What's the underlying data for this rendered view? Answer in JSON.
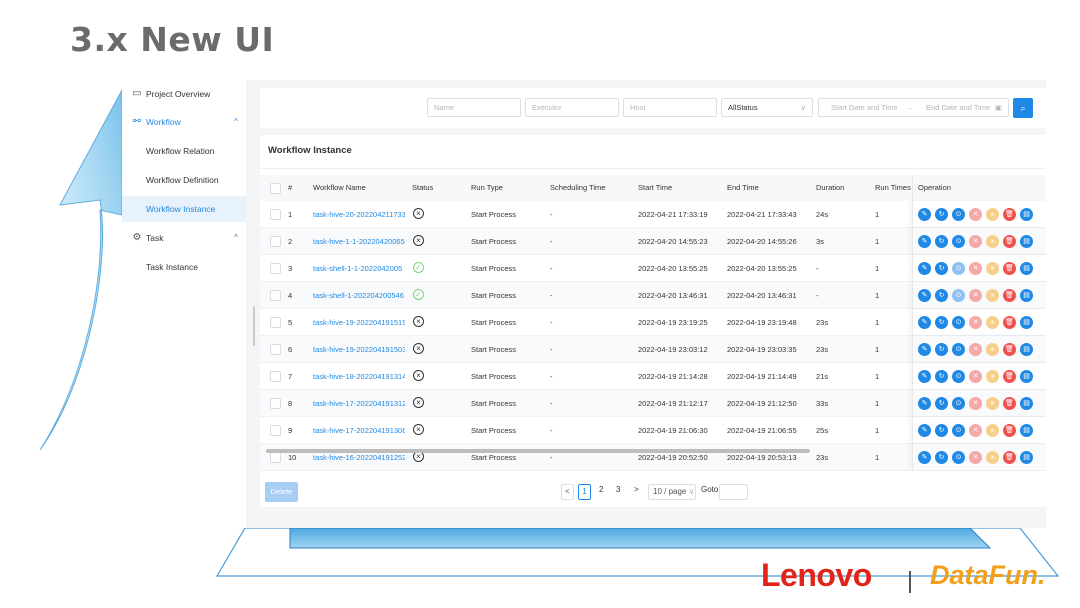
{
  "slide": {
    "title": "3.x New UI"
  },
  "sidebar": {
    "items": [
      {
        "label": "Project Overview",
        "icon": "monitor-icon"
      },
      {
        "label": "Workflow",
        "icon": "workflow-icon",
        "chevron": "^"
      },
      {
        "label": "Workflow Relation"
      },
      {
        "label": "Workflow Definition"
      },
      {
        "label": "Workflow Instance"
      },
      {
        "label": "Task",
        "icon": "gear-icon",
        "chevron": "^"
      },
      {
        "label": "Task Instance"
      }
    ]
  },
  "filters": {
    "name_placeholder": "Name",
    "executor_placeholder": "Executor",
    "host_placeholder": "Host",
    "status_value": "AllStatus",
    "start_date_placeholder": "Start Date and Time",
    "arrow": "→",
    "end_date_placeholder": "End Date and Time",
    "search_icon": "⌕"
  },
  "panel": {
    "title": "Workflow Instance"
  },
  "table": {
    "headers": {
      "index": "#",
      "name": "Workflow Name",
      "status": "Status",
      "run_type": "Run Type",
      "scheduling_time": "Scheduling Time",
      "start_time": "Start Time",
      "end_time": "End Time",
      "duration": "Duration",
      "run_times": "Run Times",
      "operation": "Operation"
    },
    "rows": [
      {
        "index": "1",
        "name": "task-hive-20-202204211733",
        "status": "fail",
        "run_type": "Start Process",
        "scheduling_time": "-",
        "start_time": "2022-04-21 17:33:19",
        "end_time": "2022-04-21 17:33:43",
        "duration": "24s",
        "run_times": "1"
      },
      {
        "index": "2",
        "name": "task-hive-1-1-20220420065",
        "status": "fail",
        "run_type": "Start Process",
        "scheduling_time": "-",
        "start_time": "2022-04-20 14:55:23",
        "end_time": "2022-04-20 14:55:26",
        "duration": "3s",
        "run_times": "1"
      },
      {
        "index": "3",
        "name": "task-shell-1-1-2022042005",
        "status": "ok",
        "run_type": "Start Process",
        "scheduling_time": "-",
        "start_time": "2022-04-20 13:55:25",
        "end_time": "2022-04-20 13:55:25",
        "duration": "-",
        "run_times": "1"
      },
      {
        "index": "4",
        "name": "task-shell-1-202204200546",
        "status": "ok",
        "run_type": "Start Process",
        "scheduling_time": "-",
        "start_time": "2022-04-20 13:46:31",
        "end_time": "2022-04-20 13:46:31",
        "duration": "-",
        "run_times": "1"
      },
      {
        "index": "5",
        "name": "task-hive-19-202204191519",
        "status": "fail",
        "run_type": "Start Process",
        "scheduling_time": "-",
        "start_time": "2022-04-19 23:19:25",
        "end_time": "2022-04-19 23:19:48",
        "duration": "23s",
        "run_times": "1"
      },
      {
        "index": "6",
        "name": "task-hive-19-202204191503",
        "status": "fail",
        "run_type": "Start Process",
        "scheduling_time": "-",
        "start_time": "2022-04-19 23:03:12",
        "end_time": "2022-04-19 23:03:35",
        "duration": "23s",
        "run_times": "1"
      },
      {
        "index": "7",
        "name": "task-hive-18-202204191314",
        "status": "fail",
        "run_type": "Start Process",
        "scheduling_time": "-",
        "start_time": "2022-04-19 21:14:28",
        "end_time": "2022-04-19 21:14:49",
        "duration": "21s",
        "run_times": "1"
      },
      {
        "index": "8",
        "name": "task-hive-17-202204191312",
        "status": "fail",
        "run_type": "Start Process",
        "scheduling_time": "-",
        "start_time": "2022-04-19 21:12:17",
        "end_time": "2022-04-19 21:12:50",
        "duration": "33s",
        "run_times": "1"
      },
      {
        "index": "9",
        "name": "task-hive-17-202204191306",
        "status": "fail",
        "run_type": "Start Process",
        "scheduling_time": "-",
        "start_time": "2022-04-19 21:06:30",
        "end_time": "2022-04-19 21:06:55",
        "duration": "25s",
        "run_times": "1"
      },
      {
        "index": "10",
        "name": "task-hive-16-202204191252",
        "status": "fail",
        "run_type": "Start Process",
        "scheduling_time": "-",
        "start_time": "2022-04-19 20:52:50",
        "end_time": "2022-04-19 20:53:13",
        "duration": "23s",
        "run_times": "1"
      }
    ],
    "operation_icons": [
      "edit-icon",
      "rerun-icon",
      "recover-icon",
      "stop-icon",
      "pause-icon",
      "delete-icon",
      "gantt-icon"
    ]
  },
  "footer": {
    "delete_label": "Delete",
    "prev": "<",
    "pages": [
      "1",
      "2",
      "3"
    ],
    "next": ">",
    "page_size": "10 / page",
    "goto_label": "Goto"
  },
  "brand": {
    "lenovo": "Lenovo",
    "datafun": "DataFun.",
    "lenovo_color": "#e2231a",
    "datafun_color": "#f0a01a",
    "accent": "#1f89e5"
  }
}
